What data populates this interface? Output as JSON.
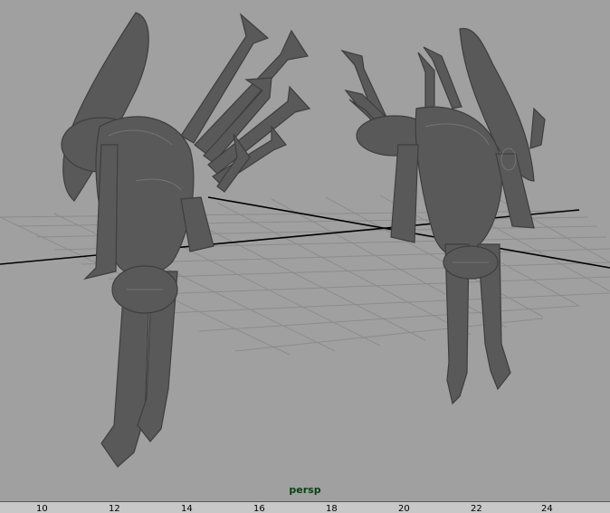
{
  "viewport": {
    "camera": "persp",
    "colors": {
      "background": "#a0a0a0",
      "grid": "#8c8c8c",
      "grid_axis": "#000000",
      "model": "#595959",
      "model_highlight": "#6e6e6e",
      "camera_label": "#0a3f14"
    },
    "models": [
      {
        "name": "creature-model-left"
      },
      {
        "name": "creature-model-right"
      }
    ]
  },
  "timeline": {
    "ticks": [
      "10",
      "12",
      "14",
      "16",
      "18",
      "20",
      "22",
      "24"
    ]
  }
}
